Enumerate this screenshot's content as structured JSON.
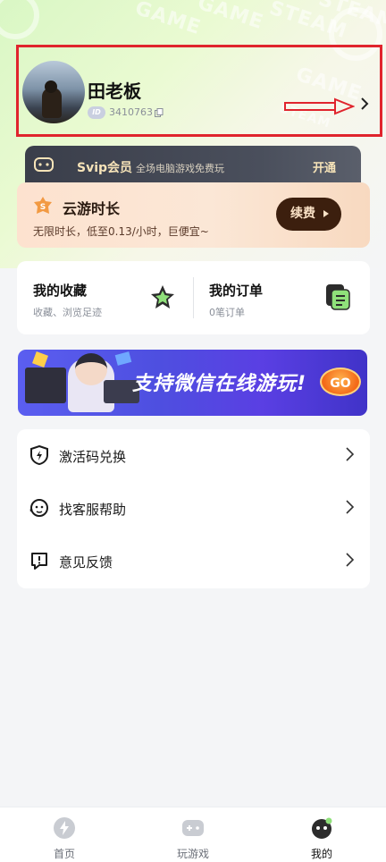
{
  "profile": {
    "username": "田老板",
    "id_badge": "ID",
    "user_id": "3410763"
  },
  "svip": {
    "title": "Svip会员",
    "subtitle": "全场电脑游戏免费玩",
    "action_label": "开通"
  },
  "cloud_time": {
    "title": "云游时长",
    "subtitle": "无限时长，低至0.13/小时，巨便宜~",
    "renew_label": "续费",
    "badge_char": "S"
  },
  "shortcuts": {
    "favorites_title": "我的收藏",
    "favorites_sub": "收藏、浏览足迹",
    "orders_title": "我的订单",
    "orders_sub": "0笔订单"
  },
  "banner": {
    "text": "支持微信在线游玩!",
    "go_label": "GO"
  },
  "menu": {
    "items": [
      {
        "label": "激活码兑换",
        "icon": "shield-icon"
      },
      {
        "label": "找客服帮助",
        "icon": "support-icon"
      },
      {
        "label": "意见反馈",
        "icon": "feedback-icon"
      }
    ]
  },
  "bottom_nav": {
    "items": [
      {
        "label": "首页",
        "icon": "home-icon",
        "active": false
      },
      {
        "label": "玩游戏",
        "icon": "gamepad-icon",
        "active": false
      },
      {
        "label": "我的",
        "icon": "profile-icon",
        "active": true
      }
    ]
  },
  "background_watermarks": [
    "GAME",
    "GAME",
    "STEAM",
    "STEAM",
    "GAME",
    "STEAM"
  ],
  "colors": {
    "annotation_red": "#e0242d",
    "svip_gold": "#f6e3b8",
    "renew_brown": "#3c1f0e",
    "banner_blue": "#4e4fe0",
    "go_orange": "#f36a18"
  }
}
